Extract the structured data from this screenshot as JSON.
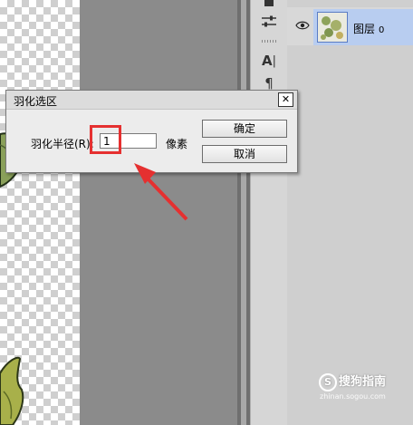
{
  "dialog": {
    "title": "羽化选区",
    "close_symbol": "✕",
    "radius_label": "羽化半径(R):",
    "radius_value": "1",
    "unit": "像素",
    "ok_label": "确定",
    "cancel_label": "取消"
  },
  "layers_panel": {
    "layer_name": "图层",
    "layer_index": "0"
  },
  "tools": [
    {
      "icon": "sliders-icon",
      "glyph": "⚌"
    },
    {
      "icon": "type-tool-icon",
      "glyph": "A|"
    },
    {
      "icon": "paragraph-icon",
      "glyph": "¶"
    }
  ],
  "watermark": {
    "badge": "S",
    "text": "搜狗指南",
    "url": "zhinan.sogou.com"
  },
  "colors": {
    "annotation_red": "#e53030",
    "layer_selected": "#b8cdf0"
  }
}
